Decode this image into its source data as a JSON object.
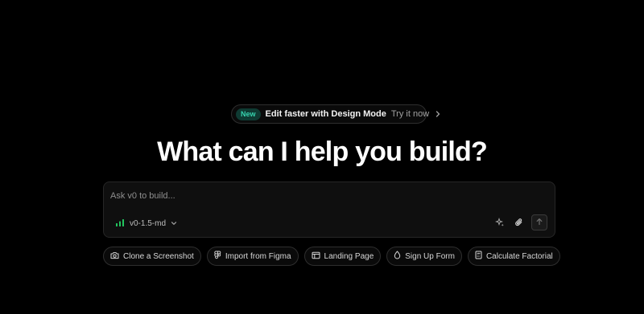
{
  "announcement": {
    "badge": "New",
    "text": "Edit faster with Design Mode",
    "cta": "Try it now",
    "chevron_icon": "chevron-right-icon",
    "badge_color": "#37d4b0"
  },
  "headline": "What can I help you build?",
  "prompt": {
    "placeholder": "Ask v0 to build...",
    "value": "",
    "model": {
      "label": "v0-1.5-md",
      "icon": "signal-bars-icon",
      "accent_color": "#22c55e"
    },
    "actions": {
      "enhance_icon": "sparkles-icon",
      "attach_icon": "paperclip-icon",
      "send_icon": "arrow-up-icon"
    }
  },
  "suggestions": [
    {
      "label": "Clone a Screenshot",
      "icon": "camera-icon"
    },
    {
      "label": "Import from Figma",
      "icon": "figma-icon"
    },
    {
      "label": "Landing Page",
      "icon": "browser-window-icon"
    },
    {
      "label": "Sign Up Form",
      "icon": "droplet-icon"
    },
    {
      "label": "Calculate Factorial",
      "icon": "calculator-icon"
    }
  ]
}
